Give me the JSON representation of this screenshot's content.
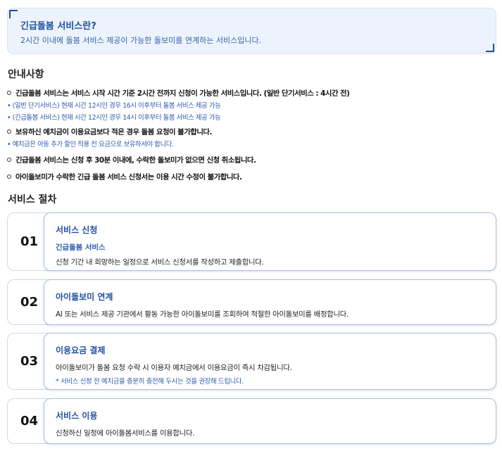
{
  "intro": {
    "title": "긴급돌봄 서비스란?",
    "description": "2시간 이내에 돌봄 서비스 제공이 가능한 돌보미를 연계하는 서비스입니다."
  },
  "notice": {
    "title": "안내사항",
    "items": [
      {
        "main": "긴급돌봄 서비스는 서비스 시작 시간 기준 2시간 전까지 신청이 가능한 서비스입니다. (일반 단기서비스 : 4시간 전)",
        "sub": [
          "• (일반 단기서비스) 현재 시간 12시인 경우 16시 이후부터 돌봄 서비스 제공 가능",
          "• (긴급돌봄 서비스) 현재 시간 12시인 경우 14시 이후부터 돌봄 서비스 제공 가능"
        ]
      },
      {
        "main": "보유하신 예치금이 이용요금보다 적은 경우 돌봄 요청이 불가합니다.",
        "sub": [
          "• 예치금은 아동 추가 할인 적용 전 요금으로 보유하셔야 합니다."
        ]
      },
      {
        "main": "긴급돌봄 서비스는 신청 후 30분 이내에, 수락한 돌보미가 없으면 신청 취소됩니다.",
        "sub": []
      },
      {
        "main": "아이돌보미가 수락한 긴급 돌봄 서비스 신청서는 이용 시간 수정이 불가합니다.",
        "sub": []
      }
    ]
  },
  "procedure": {
    "title": "서비스 절차",
    "steps": [
      {
        "num": "01",
        "title": "서비스 신청",
        "subtitle": "긴급돌봄 서비스",
        "desc": "신청 기간 내 희망하는 일정으로 서비스 신청서를 작성하고 제출합니다.",
        "note": ""
      },
      {
        "num": "02",
        "title": "아이돌보미 연계",
        "subtitle": "",
        "desc": "AI 또는 서비스 제공 기관에서 활동 가능한 아이돌보미를 조회하여 적절한 아이돌보미를 배정합니다.",
        "note": ""
      },
      {
        "num": "03",
        "title": "이용요금 결제",
        "subtitle": "",
        "desc": "아이돌보미가 돌봄 요청 수락 시 이용자 예치금에서 이용요금이 즉시 차감됩니다.",
        "note": "* 서비스 신청 전 예치금을 충분히 충전해 두시는 것을 권장해 드립니다."
      },
      {
        "num": "04",
        "title": "서비스 이용",
        "subtitle": "",
        "desc": "신청하신 일정에 아이돌봄서비스를 이용합니다.",
        "note": ""
      }
    ]
  }
}
